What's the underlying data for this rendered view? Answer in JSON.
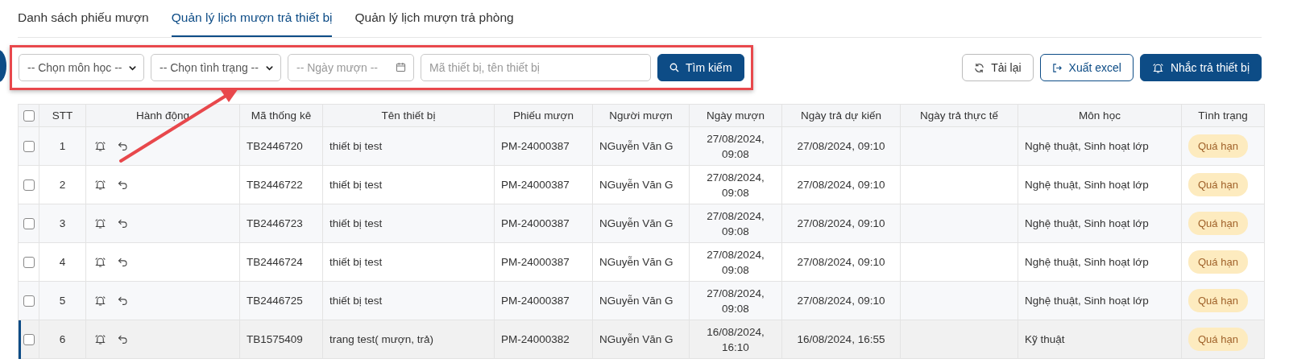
{
  "tabs": [
    {
      "label": "Danh sách phiếu mượn",
      "selected": false
    },
    {
      "label": "Quản lý lịch mượn trả thiết bị",
      "selected": true
    },
    {
      "label": "Quản lý lịch mượn trả phòng",
      "selected": false
    }
  ],
  "filters": {
    "subject": {
      "value": "-- Chọn môn học --"
    },
    "status": {
      "value": "-- Chọn tình trạng --"
    },
    "borrow_date": {
      "placeholder": "-- Ngày mượn --"
    },
    "search": {
      "placeholder": "Mã thiết bị, tên thiết bị"
    },
    "search_button": "Tìm kiếm"
  },
  "actions": [
    {
      "label": "Tải lại",
      "kind": "outline"
    },
    {
      "label": "Xuất excel",
      "kind": "outline-primary"
    },
    {
      "label": "Nhắc trả thiết bị",
      "kind": "primary"
    }
  ],
  "table": {
    "select_all": {
      "checked": false
    },
    "columns": [
      "STT",
      "Hành động",
      "Mã thống kê",
      "Tên thiết bị",
      "Phiếu mượn",
      "Người mượn",
      "Ngày mượn",
      "Ngày trả dự kiến",
      "Ngày trả thực tế",
      "Môn học",
      "Tình trạng"
    ],
    "rows": [
      {
        "checked": false,
        "selected": false,
        "stt": "1",
        "code": "TB2446720",
        "name": "thiết bị test",
        "slip": "PM-24000387",
        "borrower": "NGuyễn Văn G",
        "borrow_date": "27/08/2024, 09:08",
        "due_date": "27/08/2024, 09:10",
        "subject": "Nghệ thuật, Sinh hoạt lớp",
        "status": {
          "label": "Quá hạn",
          "kind": "overdue"
        }
      },
      {
        "checked": false,
        "selected": false,
        "stt": "2",
        "code": "TB2446722",
        "name": "thiết bị test",
        "slip": "PM-24000387",
        "borrower": "NGuyễn Văn G",
        "borrow_date": "27/08/2024, 09:08",
        "due_date": "27/08/2024, 09:10",
        "subject": "Nghệ thuật, Sinh hoạt lớp",
        "status": {
          "label": "Quá hạn",
          "kind": "overdue"
        }
      },
      {
        "checked": false,
        "selected": false,
        "stt": "3",
        "code": "TB2446723",
        "name": "thiết bị test",
        "slip": "PM-24000387",
        "borrower": "NGuyễn Văn G",
        "borrow_date": "27/08/2024, 09:08",
        "due_date": "27/08/2024, 09:10",
        "subject": "Nghệ thuật, Sinh hoạt lớp",
        "status": {
          "label": "Quá hạn",
          "kind": "overdue"
        }
      },
      {
        "checked": false,
        "selected": false,
        "stt": "4",
        "code": "TB2446724",
        "name": "thiết bị test",
        "slip": "PM-24000387",
        "borrower": "NGuyễn Văn G",
        "borrow_date": "27/08/2024, 09:08",
        "due_date": "27/08/2024, 09:10",
        "subject": "Nghệ thuật, Sinh hoạt lớp",
        "status": {
          "label": "Quá hạn",
          "kind": "overdue"
        }
      },
      {
        "checked": false,
        "selected": false,
        "stt": "5",
        "code": "TB2446725",
        "name": "thiết bị test",
        "slip": "PM-24000387",
        "borrower": "NGuyễn Văn G",
        "borrow_date": "27/08/2024, 09:08",
        "due_date": "27/08/2024, 09:10",
        "subject": "Nghệ thuật, Sinh hoạt lớp",
        "status": {
          "label": "Quá hạn",
          "kind": "overdue"
        }
      },
      {
        "checked": false,
        "selected": true,
        "stt": "6",
        "code": "TB1575409",
        "name": "trang test( mượn, trả)",
        "slip": "PM-24000382",
        "borrower": "NGuyễn Văn G",
        "borrow_date": "16/08/2024, 16:10",
        "due_date": "16/08/2024, 16:55",
        "subject": "Kỹ thuật",
        "status": {
          "label": "Quá hạn",
          "kind": "overdue"
        }
      }
    ]
  }
}
